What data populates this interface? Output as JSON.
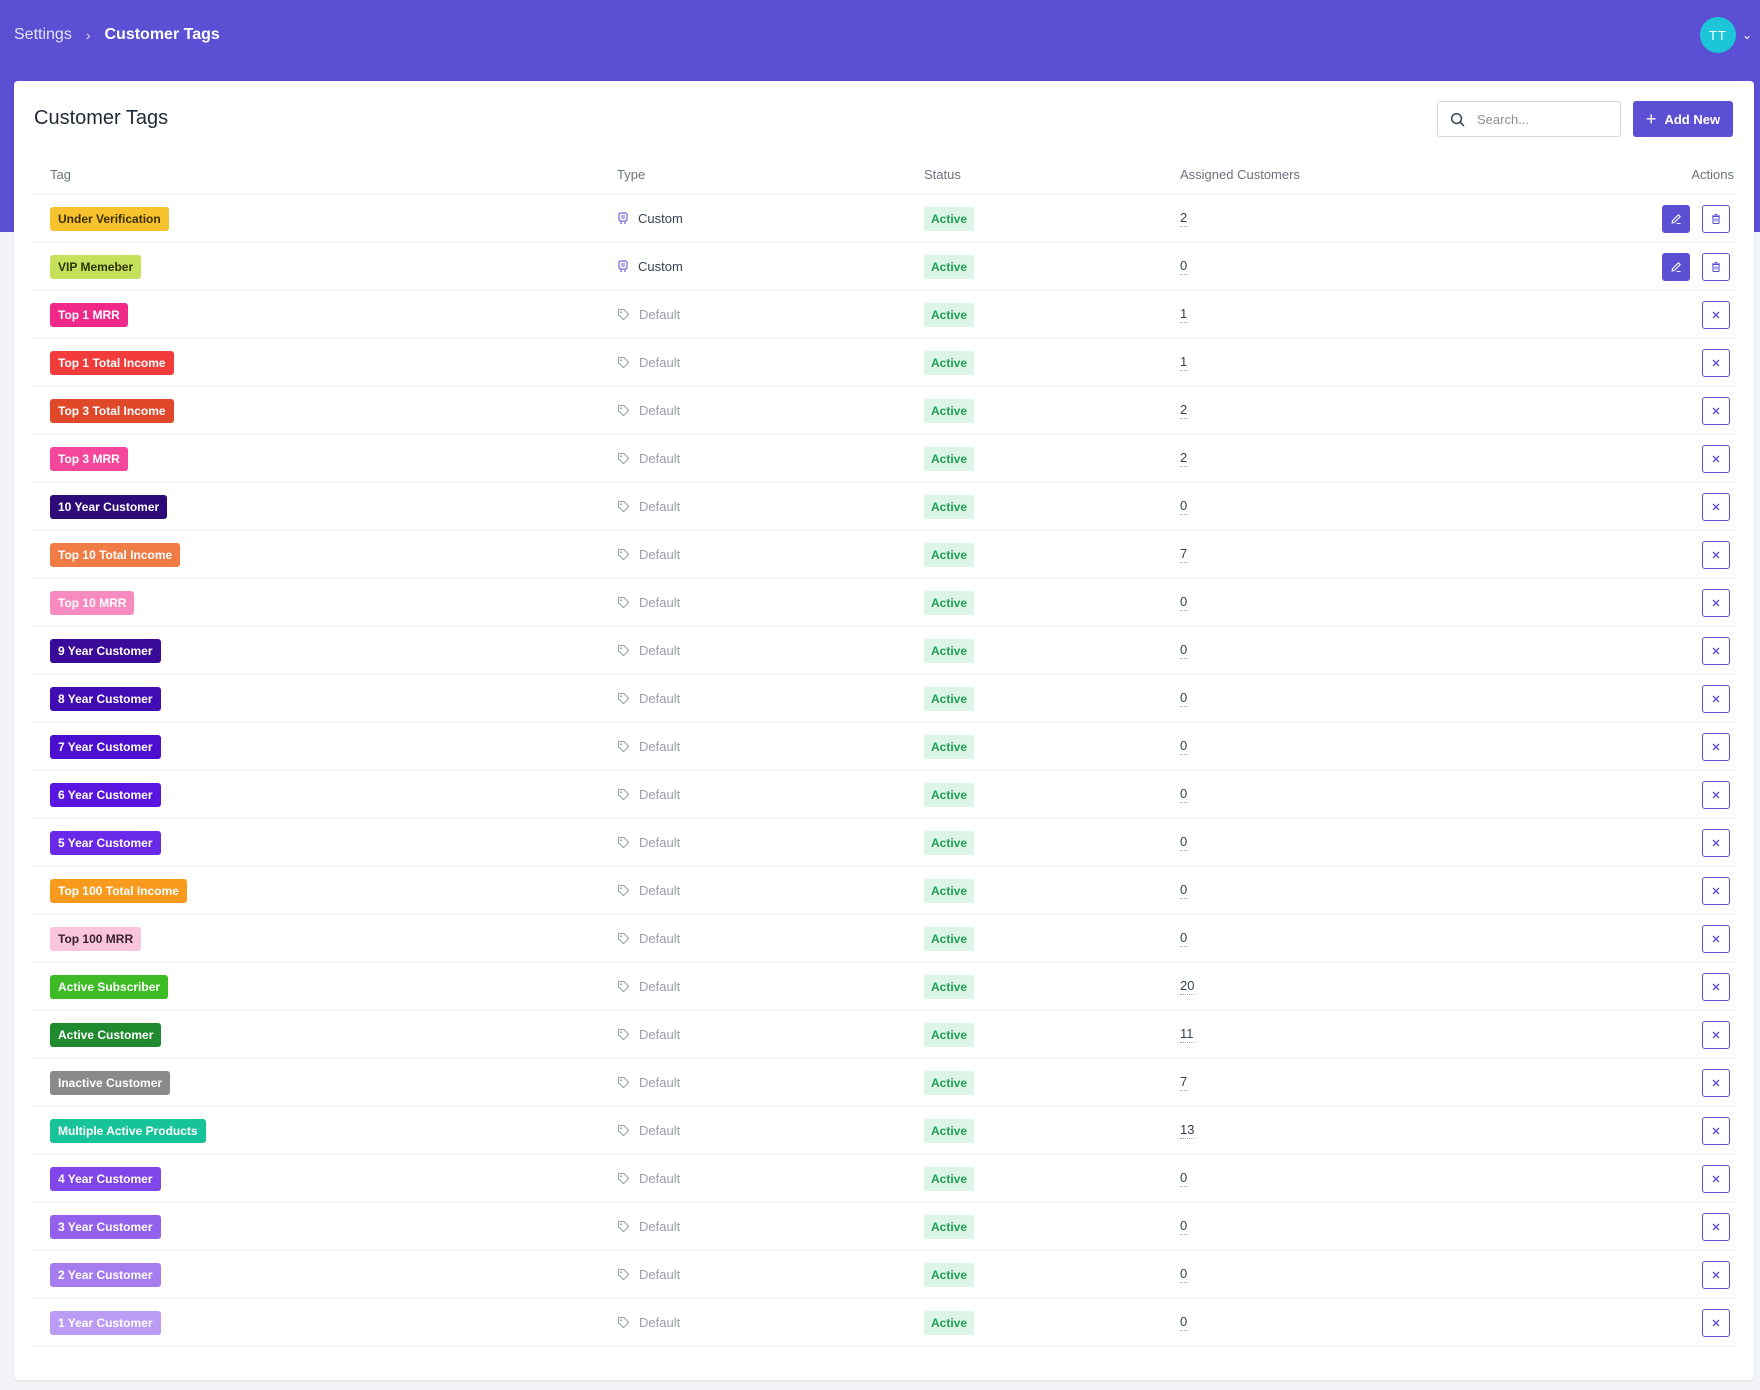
{
  "breadcrumb": {
    "parent": "Settings",
    "separator": "›",
    "current": "Customer Tags"
  },
  "user": {
    "initials": "TT",
    "menu_icon": "chevron-down-icon"
  },
  "page": {
    "title": "Customer Tags",
    "search_placeholder": "Search...",
    "add_label": "Add New"
  },
  "colors": {
    "brand": "#5b4fd3",
    "status_active_bg": "#dcf5e6",
    "status_active_text": "#1f9d55"
  },
  "table": {
    "headers": {
      "tag": "Tag",
      "type": "Type",
      "status": "Status",
      "assigned": "Assigned Customers",
      "actions": "Actions"
    },
    "rows": [
      {
        "tag": "Under Verification",
        "color": "#f7c22e",
        "text_color": "#3b2f00",
        "type": "Custom",
        "status": "Active",
        "assigned": "2",
        "actions": "edit-delete"
      },
      {
        "tag": "VIP Memeber",
        "color": "#c5e05a",
        "text_color": "#2b3300",
        "type": "Custom",
        "status": "Active",
        "assigned": "0",
        "actions": "edit-delete"
      },
      {
        "tag": "Top 1 MRR",
        "color": "#f0288a",
        "text_color": "#ffffff",
        "type": "Default",
        "status": "Active",
        "assigned": "1",
        "actions": "remove"
      },
      {
        "tag": "Top 1 Total Income",
        "color": "#f23b3b",
        "text_color": "#ffffff",
        "type": "Default",
        "status": "Active",
        "assigned": "1",
        "actions": "remove"
      },
      {
        "tag": "Top 3 Total Income",
        "color": "#e0482a",
        "text_color": "#ffffff",
        "type": "Default",
        "status": "Active",
        "assigned": "2",
        "actions": "remove"
      },
      {
        "tag": "Top 3 MRR",
        "color": "#f4479c",
        "text_color": "#ffffff",
        "type": "Default",
        "status": "Active",
        "assigned": "2",
        "actions": "remove"
      },
      {
        "tag": "10 Year Customer",
        "color": "#2e0a78",
        "text_color": "#ffffff",
        "type": "Default",
        "status": "Active",
        "assigned": "0",
        "actions": "remove"
      },
      {
        "tag": "Top 10 Total Income",
        "color": "#f07b45",
        "text_color": "#ffffff",
        "type": "Default",
        "status": "Active",
        "assigned": "7",
        "actions": "remove"
      },
      {
        "tag": "Top 10 MRR",
        "color": "#f78bbf",
        "text_color": "#ffffff",
        "type": "Default",
        "status": "Active",
        "assigned": "0",
        "actions": "remove"
      },
      {
        "tag": "9 Year Customer",
        "color": "#3a0a98",
        "text_color": "#ffffff",
        "type": "Default",
        "status": "Active",
        "assigned": "0",
        "actions": "remove"
      },
      {
        "tag": "8 Year Customer",
        "color": "#420cb4",
        "text_color": "#ffffff",
        "type": "Default",
        "status": "Active",
        "assigned": "0",
        "actions": "remove"
      },
      {
        "tag": "7 Year Customer",
        "color": "#4c0fd0",
        "text_color": "#ffffff",
        "type": "Default",
        "status": "Active",
        "assigned": "0",
        "actions": "remove"
      },
      {
        "tag": "6 Year Customer",
        "color": "#5a16e0",
        "text_color": "#ffffff",
        "type": "Default",
        "status": "Active",
        "assigned": "0",
        "actions": "remove"
      },
      {
        "tag": "5 Year Customer",
        "color": "#6a28e8",
        "text_color": "#ffffff",
        "type": "Default",
        "status": "Active",
        "assigned": "0",
        "actions": "remove"
      },
      {
        "tag": "Top 100 Total Income",
        "color": "#f79a1e",
        "text_color": "#ffffff",
        "type": "Default",
        "status": "Active",
        "assigned": "0",
        "actions": "remove"
      },
      {
        "tag": "Top 100 MRR",
        "color": "#f8c5dc",
        "text_color": "#3a2030",
        "type": "Default",
        "status": "Active",
        "assigned": "0",
        "actions": "remove"
      },
      {
        "tag": "Active Subscriber",
        "color": "#3dbb24",
        "text_color": "#ffffff",
        "type": "Default",
        "status": "Active",
        "assigned": "20",
        "actions": "remove"
      },
      {
        "tag": "Active Customer",
        "color": "#1f8a2e",
        "text_color": "#ffffff",
        "type": "Default",
        "status": "Active",
        "assigned": "11",
        "actions": "remove"
      },
      {
        "tag": "Inactive Customer",
        "color": "#8a8a8a",
        "text_color": "#ffffff",
        "type": "Default",
        "status": "Active",
        "assigned": "7",
        "actions": "remove"
      },
      {
        "tag": "Multiple Active Products",
        "color": "#17c49a",
        "text_color": "#ffffff",
        "type": "Default",
        "status": "Active",
        "assigned": "13",
        "actions": "remove"
      },
      {
        "tag": "4 Year Customer",
        "color": "#8046ea",
        "text_color": "#ffffff",
        "type": "Default",
        "status": "Active",
        "assigned": "0",
        "actions": "remove"
      },
      {
        "tag": "3 Year Customer",
        "color": "#9461ec",
        "text_color": "#ffffff",
        "type": "Default",
        "status": "Active",
        "assigned": "0",
        "actions": "remove"
      },
      {
        "tag": "2 Year Customer",
        "color": "#a67df0",
        "text_color": "#ffffff",
        "type": "Default",
        "status": "Active",
        "assigned": "0",
        "actions": "remove"
      },
      {
        "tag": "1 Year Customer",
        "color": "#bb9bf4",
        "text_color": "#ffffff",
        "type": "Default",
        "status": "Active",
        "assigned": "0",
        "actions": "remove"
      }
    ]
  }
}
